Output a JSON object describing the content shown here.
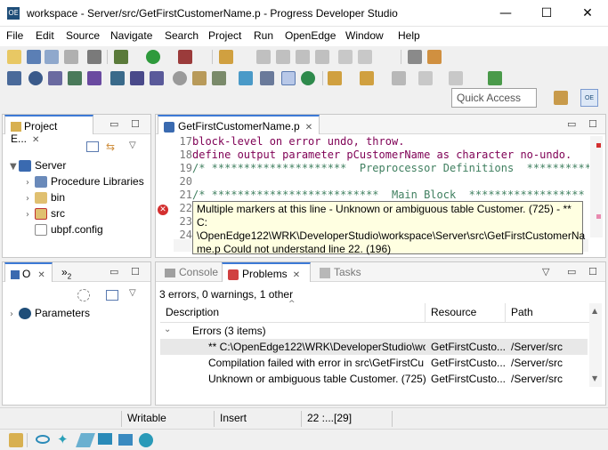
{
  "window": {
    "title": "workspace - Server/src/GetFirstCustomerName.p - Progress Developer Studio",
    "app_icon": "OE",
    "minimize": "—",
    "maximize": "☐",
    "close": "✕"
  },
  "menu": [
    "File",
    "Edit",
    "Source",
    "Navigate",
    "Search",
    "Project",
    "Run",
    "OpenEdge",
    "Window",
    "Help"
  ],
  "quick_access": {
    "placeholder": "Quick Access"
  },
  "project_explorer": {
    "tab_label": "Project E...",
    "tree": {
      "root": "Server",
      "children": [
        "Procedure Libraries",
        "bin",
        "src",
        "ubpf.config"
      ]
    }
  },
  "outline": {
    "tab_label": "O",
    "second_tab": "»",
    "second_tab_count": "2",
    "tree": [
      "Parameters"
    ]
  },
  "editor": {
    "tab_label": "GetFirstCustomerName.p",
    "lines": [
      {
        "num": "17",
        "text": "block-level on error undo, throw."
      },
      {
        "num": "18",
        "text": "define output parameter pCustomerName as character no-undo."
      },
      {
        "num": "19",
        "text": "/* *********************  Preprocessor Definitions  **********"
      },
      {
        "num": "20",
        "text": ""
      },
      {
        "num": "21",
        "text": "/* **************************  Main Block  ******************"
      },
      {
        "num": "22",
        "text": ""
      },
      {
        "num": "23",
        "text": ""
      },
      {
        "num": "24",
        "text": ""
      }
    ],
    "tooltip": {
      "line1": "Multiple markers at this line - Unknown or ambiguous table Customer. (725) - **",
      "line2": "C:",
      "line3": "\\OpenEdge122\\WRK\\DeveloperStudio\\workspace\\Server\\src\\GetFirstCustomerNa",
      "line4": "me.p Could not understand line 22. (196)"
    }
  },
  "bottom_panel": {
    "tabs": [
      "Console",
      "Problems",
      "Tasks"
    ],
    "active_tab": "Problems",
    "summary": "3 errors, 0 warnings, 1 other",
    "columns": [
      "Description",
      "Resource",
      "Path"
    ],
    "group": "Errors (3 items)",
    "rows": [
      {
        "description": "** C:\\OpenEdge122\\WRK\\DeveloperStudio\\wo",
        "resource": "GetFirstCusto...",
        "path": "/Server/src"
      },
      {
        "description": "Compilation failed with error in src\\GetFirstCu",
        "resource": "GetFirstCusto...",
        "path": "/Server/src"
      },
      {
        "description": "Unknown or ambiguous table Customer. (725)",
        "resource": "GetFirstCusto...",
        "path": "/Server/src"
      }
    ]
  },
  "status": {
    "writable": "Writable",
    "insert": "Insert",
    "position": "22 :...[29]"
  }
}
